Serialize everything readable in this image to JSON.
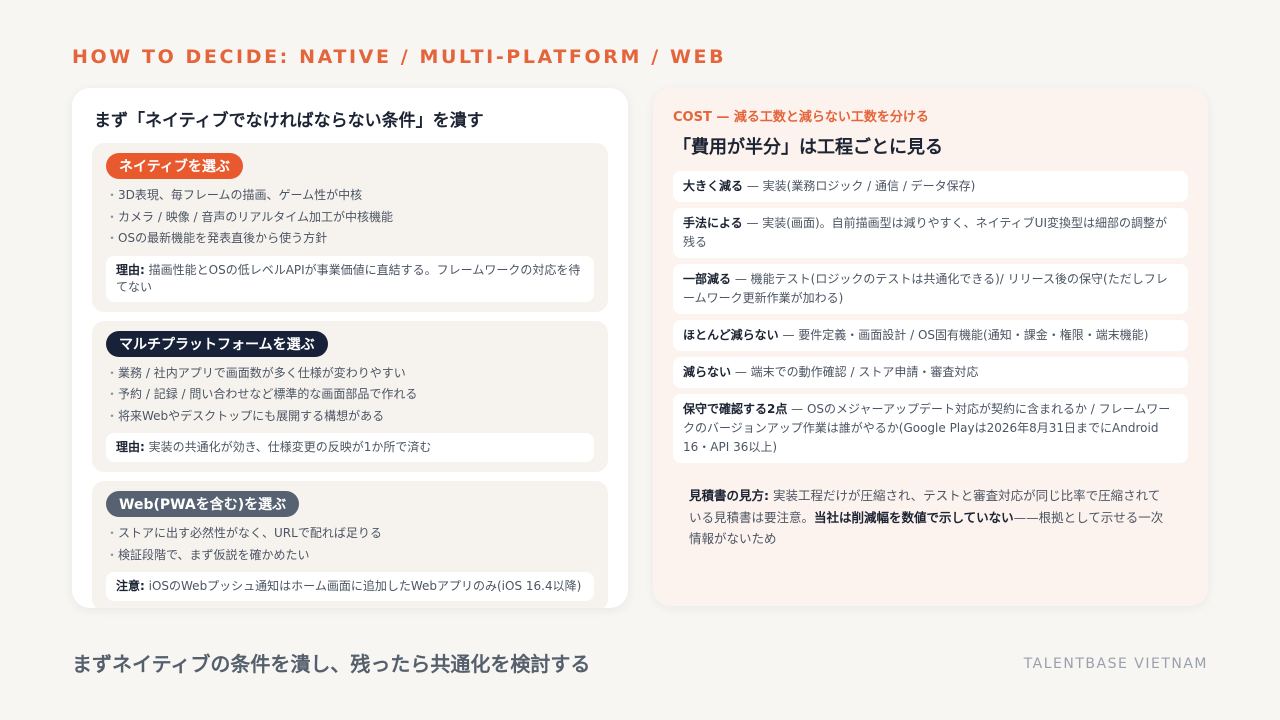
{
  "kicker": "HOW TO DECIDE: NATIVE / MULTI-PLATFORM / WEB",
  "left": {
    "title": "まず「ネイティブでなければならない条件」を潰す",
    "sections": [
      {
        "pill": "ネイティブを選ぶ",
        "color": "#e85a2e",
        "bullets": [
          "3D表現、毎フレームの描画、ゲーム性が中核",
          "カメラ / 映像 / 音声のリアルタイム加工が中核機能",
          "OSの最新機能を発表直後から使う方針"
        ],
        "note_label": "理由:",
        "note_text": " 描画性能とOSの低レベルAPIが事業価値に直結する。フレームワークの対応を待てない"
      },
      {
        "pill": "マルチプラットフォームを選ぶ",
        "color": "#172238",
        "bullets": [
          "業務 / 社内アプリで画面数が多く仕様が変わりやすい",
          "予約 / 記録 / 問い合わせなど標準的な画面部品で作れる",
          "将来Webやデスクトップにも展開する構想がある"
        ],
        "note_label": "理由:",
        "note_text": " 実装の共通化が効き、仕様変更の反映が1か所で済む"
      },
      {
        "pill": "Web(PWAを含む)を選ぶ",
        "color": "#566271",
        "bullets": [
          "ストアに出す必然性がなく、URLで配れば足りる",
          "検証段階で、まず仮説を確かめたい"
        ],
        "note_label": "注意:",
        "note_text": " iOSのWebプッシュ通知はホーム画面に追加したWebアプリのみ(iOS 16.4以降)"
      }
    ]
  },
  "right": {
    "kicker_a": "COST",
    "kicker_dash": " — ",
    "kicker_b": "減る工数と減らない工数を分ける",
    "title": "「費用が半分」は工程ごとに見る",
    "rows": [
      {
        "label": "大きく減る",
        "text": " — 実装(業務ロジック / 通信 / データ保存)"
      },
      {
        "label": "手法による",
        "text": " — 実装(画面)。自前描画型は減りやすく、ネイティブUI変換型は細部の調整が残る"
      },
      {
        "label": "一部減る",
        "text": " — 機能テスト(ロジックのテストは共通化できる)/ リリース後の保守(ただしフレームワーク更新作業が加わる)"
      },
      {
        "label": "ほとんど減らない",
        "text": " — 要件定義・画面設計 / OS固有機能(通知・課金・権限・端末機能)"
      },
      {
        "label": "減らない",
        "text": " — 端末での動作確認 / ストア申請・審査対応"
      },
      {
        "label": "保守で確認する2点",
        "text": " — OSのメジャーアップデート対応が契約に含まれるか / フレームワークのバージョンアップ作業は誰がやるか(Google Playは2026年8月31日までにAndroid 16・API 36以上)"
      }
    ],
    "note": {
      "label": "見積書の見方:",
      "text1": " 実装工程だけが圧縮され、テストと審査対応が同じ比率で圧縮されている見積書は要注意。",
      "bold2": "当社は削減幅を数値で示していない",
      "text2": "——根拠として示せる一次情報がないため"
    }
  },
  "footer": {
    "message": "まずネイティブの条件を潰し、残ったら共通化を検討する",
    "brand": "TALENTBASE VIETNAM"
  }
}
